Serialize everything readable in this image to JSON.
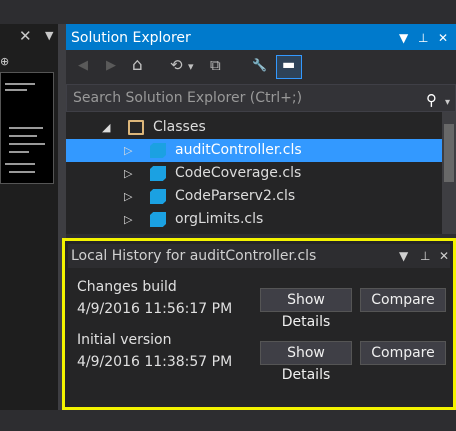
{
  "editor_strip": {
    "close_glyph": "✕",
    "dropdown_glyph": "▼",
    "pin_glyph": "⊕"
  },
  "solution_explorer": {
    "title": "Solution Explorer",
    "title_buttons": {
      "dropdown": "▼",
      "pin": "⊥",
      "close": "✕"
    },
    "toolbar": {
      "back": "◀",
      "forward": "▶",
      "home": "⌂",
      "history": "⟲",
      "history_dd": "▾",
      "sync": "⧉",
      "properties": "🔧",
      "preview": "▬"
    },
    "search": {
      "placeholder": "Search Solution Explorer (Ctrl+;)",
      "icon": "⚲",
      "dropdown": "▾"
    },
    "tree": {
      "folder": {
        "label": "Classes",
        "arrow": "◢"
      },
      "items": [
        {
          "label": "auditController.cls",
          "arrow": "▷",
          "selected": true
        },
        {
          "label": "CodeCoverage.cls",
          "arrow": "▷",
          "selected": false
        },
        {
          "label": "CodeParserv2.cls",
          "arrow": "▷",
          "selected": false
        },
        {
          "label": "orgLimits.cls",
          "arrow": "▷",
          "selected": false
        }
      ]
    }
  },
  "local_history": {
    "title": "Local History for auditController.cls",
    "title_buttons": {
      "dropdown": "▼",
      "pin": "⊥",
      "close": "✕"
    },
    "entries": [
      {
        "name": "Changes build",
        "timestamp": "4/9/2016 11:56:17 PM",
        "details_label": "Show Details",
        "compare_label": "Compare"
      },
      {
        "name": "Initial version",
        "timestamp": "4/9/2016 11:38:57 PM",
        "details_label": "Show Details",
        "compare_label": "Compare"
      }
    ]
  },
  "colors": {
    "accent": "#007acc",
    "selection": "#3399ff",
    "highlight_border": "#f3f300",
    "background": "#2d2d30"
  }
}
